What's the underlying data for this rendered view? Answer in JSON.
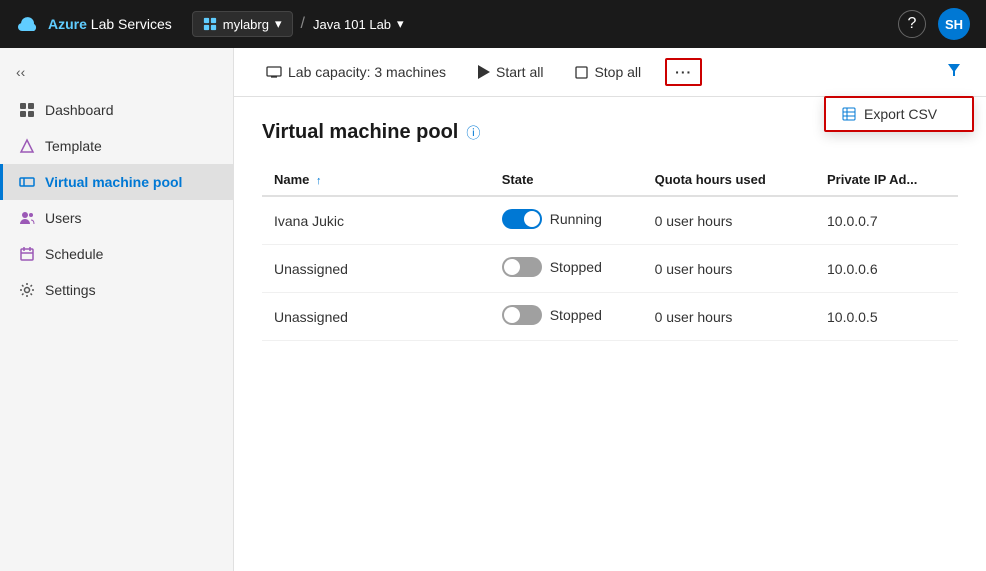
{
  "topbar": {
    "logo_text": "Azure Lab Services",
    "logo_azure": "Azure",
    "logo_suffix": " Lab Services",
    "org_name": "mylabrg",
    "separator": "/",
    "lab_name": "Java 101 Lab",
    "help_label": "?",
    "avatar_label": "SH"
  },
  "sidebar": {
    "collapse_icon": "«",
    "items": [
      {
        "id": "dashboard",
        "label": "Dashboard",
        "icon": "⊞",
        "active": false
      },
      {
        "id": "template",
        "label": "Template",
        "icon": "△",
        "active": false
      },
      {
        "id": "vm-pool",
        "label": "Virtual machine pool",
        "icon": "▭",
        "active": true
      },
      {
        "id": "users",
        "label": "Users",
        "icon": "👤",
        "active": false
      },
      {
        "id": "schedule",
        "label": "Schedule",
        "icon": "📅",
        "active": false
      },
      {
        "id": "settings",
        "label": "Settings",
        "icon": "⚙",
        "active": false
      }
    ]
  },
  "toolbar": {
    "capacity_label": "Lab capacity: 3 machines",
    "start_all_label": "Start all",
    "stop_all_label": "Stop all",
    "more_label": "···",
    "filter_label": "⊿"
  },
  "dropdown": {
    "items": [
      {
        "id": "export-csv",
        "label": "Export CSV",
        "icon": "▦"
      }
    ]
  },
  "page": {
    "title": "Virtual machine pool",
    "info_icon": "ⓘ"
  },
  "table": {
    "columns": [
      {
        "id": "name",
        "label": "Name",
        "sort": "↑"
      },
      {
        "id": "state",
        "label": "State",
        "sort": ""
      },
      {
        "id": "quota",
        "label": "Quota hours used",
        "sort": ""
      },
      {
        "id": "ip",
        "label": "Private IP Ad...",
        "sort": ""
      }
    ],
    "rows": [
      {
        "name": "Ivana Jukic",
        "state": "Running",
        "state_on": true,
        "quota": "0 user hours",
        "ip": "10.0.0.7"
      },
      {
        "name": "Unassigned",
        "state": "Stopped",
        "state_on": false,
        "quota": "0 user hours",
        "ip": "10.0.0.6"
      },
      {
        "name": "Unassigned",
        "state": "Stopped",
        "state_on": false,
        "quota": "0 user hours",
        "ip": "10.0.0.5"
      }
    ]
  },
  "colors": {
    "accent": "#0078d4",
    "topbar_bg": "#1a1a1a",
    "sidebar_bg": "#f5f5f5",
    "active_border": "#0078d4",
    "toggle_on": "#0078d4",
    "toggle_off": "#a0a0a0"
  }
}
